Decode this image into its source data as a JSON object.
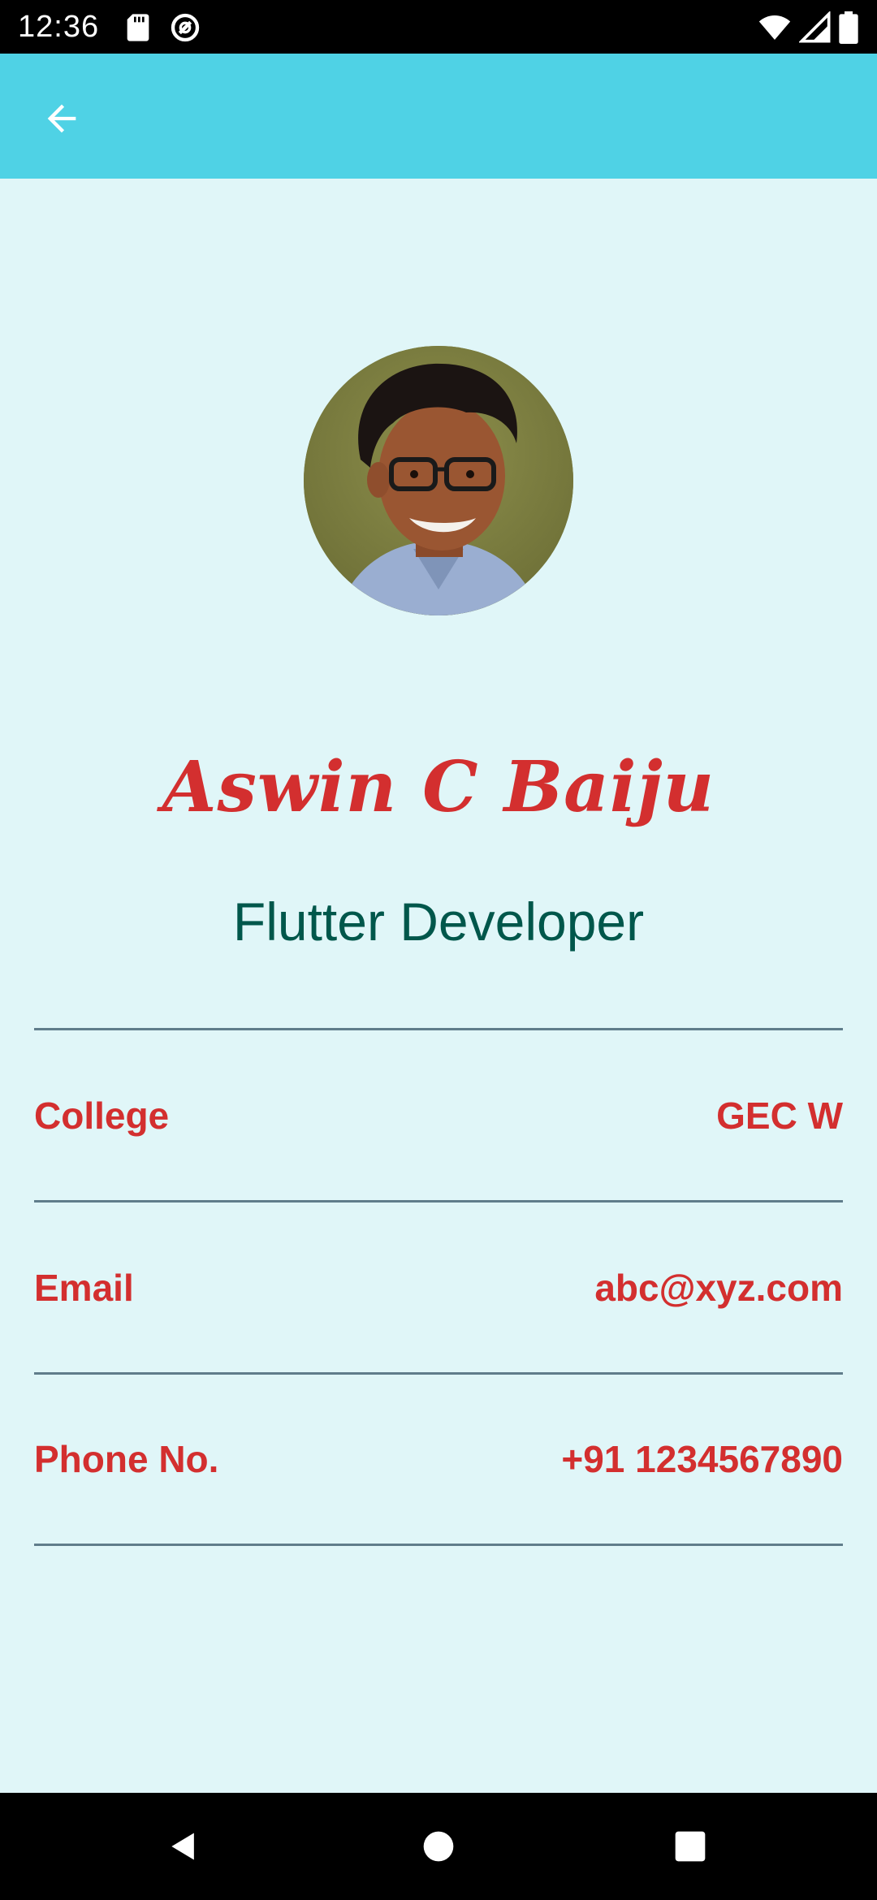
{
  "status_bar": {
    "time": "12:36",
    "icons": [
      "sd-card-icon",
      "data-saver-icon",
      "wifi-icon",
      "signal-icon",
      "battery-icon"
    ]
  },
  "app_bar": {
    "back_icon": "arrow-back-icon",
    "background_color": "#4fd2e5"
  },
  "profile": {
    "avatar": "profile-photo",
    "name": "Aswin C Baiju",
    "role": "Flutter Developer",
    "name_color": "#d32f2f",
    "role_color": "#00574b"
  },
  "info": [
    {
      "label": "College",
      "value": "GEC W"
    },
    {
      "label": "Email",
      "value": "abc@xyz.com"
    },
    {
      "label": "Phone No.",
      "value": "+91 1234567890"
    }
  ],
  "nav_bar": {
    "icons": [
      "back-triangle-icon",
      "home-circle-icon",
      "recents-square-icon"
    ]
  }
}
